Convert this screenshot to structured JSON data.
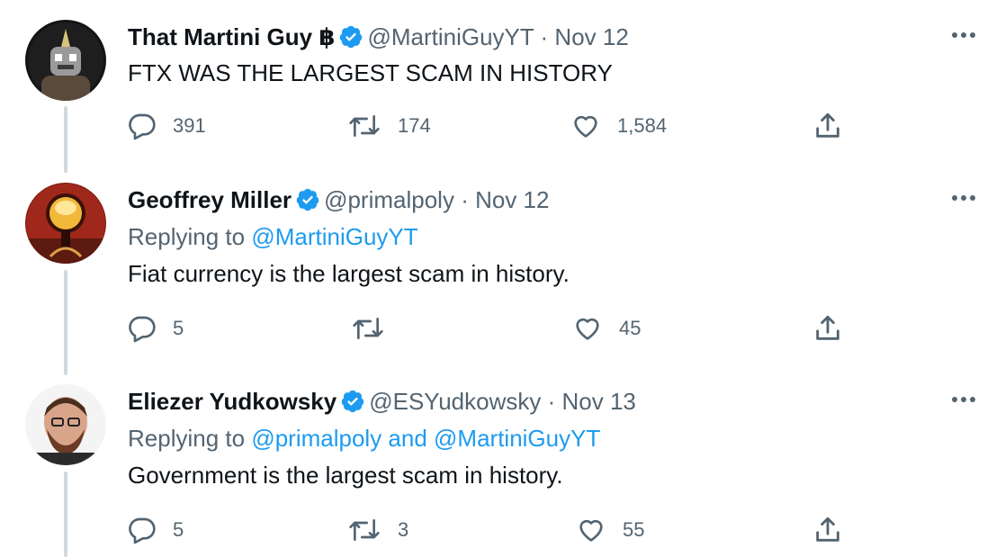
{
  "tweets": [
    {
      "author": "That Martini Guy ฿",
      "handle": "@MartiniGuyYT",
      "separator": "·",
      "date": "Nov 12",
      "replying_prefix": "",
      "replying_mentions": "",
      "text": "FTX WAS THE LARGEST SCAM IN HISTORY",
      "reply_count": "391",
      "retweet_count": "174",
      "like_count": "1,584"
    },
    {
      "author": "Geoffrey Miller",
      "handle": "@primalpoly",
      "separator": "·",
      "date": "Nov 12",
      "replying_prefix": "Replying to ",
      "replying_mentions": "@MartiniGuyYT",
      "text": "Fiat currency is the largest scam in history.",
      "reply_count": "5",
      "retweet_count": "",
      "like_count": "45"
    },
    {
      "author": "Eliezer Yudkowsky",
      "handle": "@ESYudkowsky",
      "separator": "·",
      "date": "Nov 13",
      "replying_prefix": "Replying to ",
      "replying_mentions": "@primalpoly and @MartiniGuyYT",
      "text": "Government is the largest scam in history.",
      "reply_count": "5",
      "retweet_count": "3",
      "like_count": "55"
    }
  ],
  "icons": {
    "verified": "verified-badge-icon",
    "more": "more-options-icon",
    "reply": "reply-icon",
    "retweet": "retweet-icon",
    "like": "like-icon",
    "share": "share-icon"
  },
  "colors": {
    "accent": "#1d9bf0",
    "text_primary": "#0f1419",
    "text_secondary": "#536471",
    "thread_line": "#cfd9de"
  }
}
